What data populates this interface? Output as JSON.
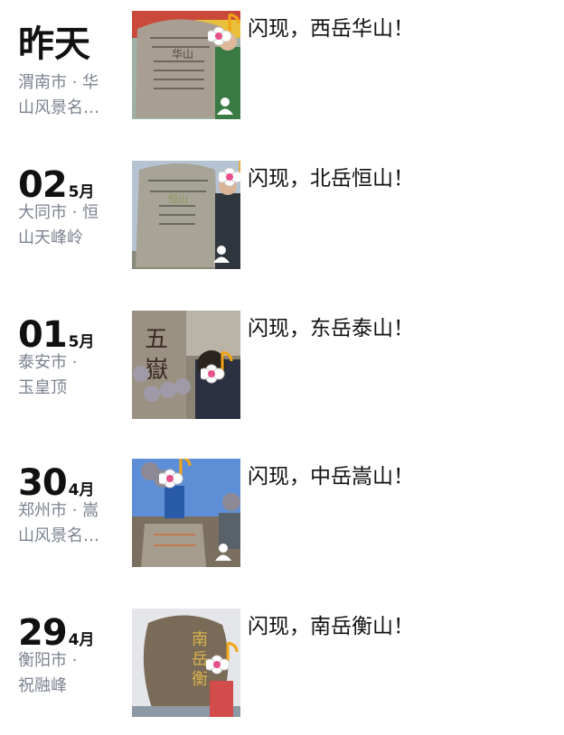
{
  "posts": [
    {
      "day": "昨天",
      "month": "",
      "location_line1": "渭南市 · 华",
      "location_line2": "山风景名…",
      "text": "闪现，西岳华山！"
    },
    {
      "day": "02",
      "month": "5月",
      "location_line1": "大同市 · 恒",
      "location_line2": "山天峰岭",
      "text": "闪现，北岳恒山！"
    },
    {
      "day": "01",
      "month": "5月",
      "location_line1": "泰安市 ·",
      "location_line2": "玉皇顶",
      "text": "闪现，东岳泰山！"
    },
    {
      "day": "30",
      "month": "4月",
      "location_line1": "郑州市 · 嵩",
      "location_line2": "山风景名…",
      "text": "闪现，中岳嵩山！"
    },
    {
      "day": "29",
      "month": "4月",
      "location_line1": "衡阳市 ·",
      "location_line2": "祝融峰",
      "text": "闪现，南岳衡山！"
    }
  ],
  "photos": [
    {
      "icon": "stone-monument-photo",
      "sticker": "flower-music-sticker",
      "badge": "person-icon"
    },
    {
      "icon": "stone-monument-photo",
      "sticker": "flower-music-sticker",
      "badge": "person-icon"
    },
    {
      "icon": "rock-carving-photo",
      "sticker": "flower-music-sticker",
      "badge": ""
    },
    {
      "icon": "summit-group-photo",
      "sticker": "flower-music-sticker",
      "badge": "person-icon"
    },
    {
      "icon": "boulder-inscription-photo",
      "sticker": "flower-music-sticker",
      "badge": ""
    }
  ]
}
